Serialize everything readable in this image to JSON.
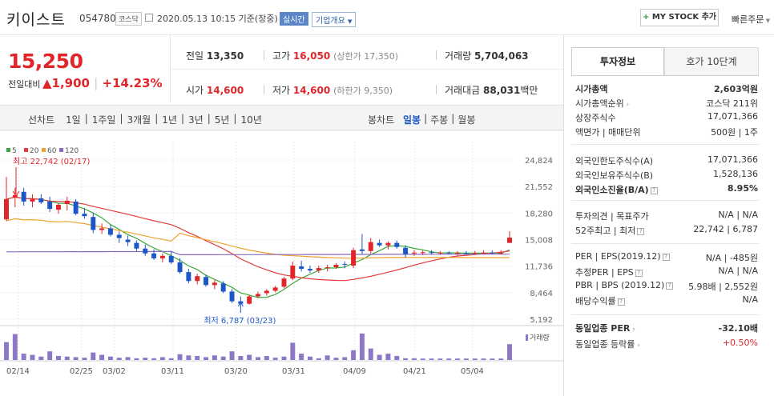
{
  "header": {
    "stock_name": "키이스트",
    "stock_code": "054780",
    "market": "코스닥",
    "datetime": "2020.05.13 10:15 기준(장중)",
    "realtime": "실시간",
    "company_info": "기업개요",
    "mystock": "MY STOCK 추가",
    "quick_order": "빠른주문"
  },
  "price": {
    "current": "15,250",
    "change_label": "전일대비",
    "change_amount": "1,900",
    "change_pct": "+14.23%",
    "prev_label": "전일",
    "prev": "13,350",
    "high_label": "고가",
    "high": "16,050",
    "upper_limit": "(상한가 17,350)",
    "volume_label": "거래량",
    "volume": "5,704,063",
    "open_label": "시가",
    "open": "14,600",
    "low_label": "저가",
    "low": "14,600",
    "lower_limit": "(하한가 9,350)",
    "amount_label": "거래대금",
    "amount": "88,031",
    "amount_unit": "백만"
  },
  "periods": {
    "line_chart": "선차트",
    "items": [
      "1일",
      "1주일",
      "3개월",
      "1년",
      "3년",
      "5년",
      "10년"
    ],
    "candle_chart": "봉차트",
    "candle_items": [
      "일봉",
      "주봉",
      "월봉"
    ],
    "candle_active": "일봉"
  },
  "chart_data": {
    "type": "candlestick",
    "legend": [
      "5",
      "20",
      "60",
      "120"
    ],
    "legend_colors": [
      "#3aa83a",
      "#e33b3b",
      "#f0a030",
      "#8b6bc0"
    ],
    "y_ticks": [
      "24,824",
      "21,552",
      "18,280",
      "15,008",
      "11,736",
      "8,464",
      "5,192"
    ],
    "ylim": [
      5192,
      24824
    ],
    "x_labels": [
      "02/14",
      "02/25",
      "03/02",
      "03/11",
      "03/20",
      "03/31",
      "04/09",
      "04/21",
      "05/04"
    ],
    "high_label": "최고 22,742 (02/17)",
    "low_label": "최저 6,787 (03/23)",
    "volume_label": "거래량",
    "candles": [
      {
        "o": 17500,
        "h": 22742,
        "l": 17300,
        "c": 20000
      },
      {
        "o": 20200,
        "h": 21400,
        "l": 19000,
        "c": 20500
      },
      {
        "o": 20900,
        "h": 21400,
        "l": 19200,
        "c": 19700
      },
      {
        "o": 19700,
        "h": 20600,
        "l": 19000,
        "c": 20000
      },
      {
        "o": 20100,
        "h": 20600,
        "l": 19400,
        "c": 19600
      },
      {
        "o": 19700,
        "h": 20300,
        "l": 18400,
        "c": 18800
      },
      {
        "o": 18700,
        "h": 19500,
        "l": 18200,
        "c": 19300
      },
      {
        "o": 19400,
        "h": 20300,
        "l": 18600,
        "c": 19800
      },
      {
        "o": 19700,
        "h": 20000,
        "l": 18000,
        "c": 18200
      },
      {
        "o": 18200,
        "h": 18900,
        "l": 17600,
        "c": 17900
      },
      {
        "o": 17800,
        "h": 18300,
        "l": 15800,
        "c": 16200
      },
      {
        "o": 16200,
        "h": 17000,
        "l": 15700,
        "c": 16400
      },
      {
        "o": 16400,
        "h": 16800,
        "l": 15400,
        "c": 15600
      },
      {
        "o": 15600,
        "h": 16000,
        "l": 14600,
        "c": 15200
      },
      {
        "o": 15000,
        "h": 15500,
        "l": 14200,
        "c": 14700
      },
      {
        "o": 14600,
        "h": 14900,
        "l": 13600,
        "c": 13900
      },
      {
        "o": 13900,
        "h": 14400,
        "l": 13000,
        "c": 13300
      },
      {
        "o": 13300,
        "h": 13800,
        "l": 12500,
        "c": 12700
      },
      {
        "o": 12700,
        "h": 13300,
        "l": 12200,
        "c": 13000
      },
      {
        "o": 13000,
        "h": 13600,
        "l": 12000,
        "c": 12200
      },
      {
        "o": 12200,
        "h": 12700,
        "l": 10800,
        "c": 11000
      },
      {
        "o": 11000,
        "h": 11400,
        "l": 9600,
        "c": 9900
      },
      {
        "o": 9900,
        "h": 10800,
        "l": 9500,
        "c": 10500
      },
      {
        "o": 10400,
        "h": 10700,
        "l": 9200,
        "c": 9400
      },
      {
        "o": 9400,
        "h": 10000,
        "l": 8900,
        "c": 9700
      },
      {
        "o": 9600,
        "h": 9900,
        "l": 8400,
        "c": 8600
      },
      {
        "o": 8600,
        "h": 8900,
        "l": 7200,
        "c": 7400
      },
      {
        "o": 7400,
        "h": 8000,
        "l": 6787,
        "c": 7100
      },
      {
        "o": 7100,
        "h": 8200,
        "l": 7000,
        "c": 8000
      },
      {
        "o": 8000,
        "h": 8600,
        "l": 7800,
        "c": 8300
      },
      {
        "o": 8400,
        "h": 8900,
        "l": 8100,
        "c": 8700
      },
      {
        "o": 8700,
        "h": 9300,
        "l": 8500,
        "c": 9100
      },
      {
        "o": 9200,
        "h": 10400,
        "l": 9000,
        "c": 10200
      },
      {
        "o": 10200,
        "h": 12300,
        "l": 10000,
        "c": 11800
      },
      {
        "o": 11700,
        "h": 12400,
        "l": 11100,
        "c": 11400
      },
      {
        "o": 11400,
        "h": 11800,
        "l": 10900,
        "c": 11200
      },
      {
        "o": 11200,
        "h": 11800,
        "l": 10900,
        "c": 11500
      },
      {
        "o": 11500,
        "h": 11900,
        "l": 11100,
        "c": 11600
      },
      {
        "o": 11600,
        "h": 12100,
        "l": 11400,
        "c": 11900
      },
      {
        "o": 12000,
        "h": 12300,
        "l": 11500,
        "c": 11900
      },
      {
        "o": 11800,
        "h": 14000,
        "l": 11500,
        "c": 13700
      },
      {
        "o": 13800,
        "h": 15700,
        "l": 13200,
        "c": 13600
      },
      {
        "o": 13600,
        "h": 15200,
        "l": 13300,
        "c": 14700
      },
      {
        "o": 14600,
        "h": 15000,
        "l": 14100,
        "c": 14300
      },
      {
        "o": 14300,
        "h": 14800,
        "l": 13800,
        "c": 14600
      },
      {
        "o": 14600,
        "h": 14900,
        "l": 13900,
        "c": 14100
      },
      {
        "o": 14000,
        "h": 14300,
        "l": 12800,
        "c": 13200
      },
      {
        "o": 13300,
        "h": 13700,
        "l": 13000,
        "c": 13400
      },
      {
        "o": 13400,
        "h": 13700,
        "l": 13100,
        "c": 13450
      },
      {
        "o": 13450,
        "h": 13700,
        "l": 13150,
        "c": 13350
      },
      {
        "o": 13350,
        "h": 13600,
        "l": 13150,
        "c": 13400
      },
      {
        "o": 13400,
        "h": 13600,
        "l": 13200,
        "c": 13300
      },
      {
        "o": 13300,
        "h": 13600,
        "l": 13100,
        "c": 13350
      },
      {
        "o": 13350,
        "h": 13600,
        "l": 13150,
        "c": 13300
      },
      {
        "o": 13300,
        "h": 13600,
        "l": 13150,
        "c": 13350
      },
      {
        "o": 13350,
        "h": 13700,
        "l": 13200,
        "c": 13400
      },
      {
        "o": 13400,
        "h": 13650,
        "l": 13200,
        "c": 13350
      },
      {
        "o": 13350,
        "h": 13700,
        "l": 13200,
        "c": 13350
      },
      {
        "o": 14600,
        "h": 16050,
        "l": 14600,
        "c": 15250
      }
    ],
    "volumes": [
      0.62,
      0.9,
      0.22,
      0.18,
      0.12,
      0.3,
      0.14,
      0.12,
      0.1,
      0.08,
      0.26,
      0.18,
      0.12,
      0.08,
      0.1,
      0.06,
      0.08,
      0.06,
      0.1,
      0.06,
      0.2,
      0.16,
      0.14,
      0.1,
      0.16,
      0.12,
      0.3,
      0.14,
      0.18,
      0.1,
      0.14,
      0.08,
      0.12,
      0.6,
      0.22,
      0.12,
      0.06,
      0.16,
      0.08,
      0.1,
      0.34,
      0.92,
      0.4,
      0.18,
      0.22,
      0.14,
      0.06,
      0.06,
      0.05,
      0.05,
      0.05,
      0.05,
      0.05,
      0.05,
      0.05,
      0.05,
      0.05,
      0.05,
      0.55
    ]
  },
  "panel": {
    "tab_invest": "투자정보",
    "tab_order": "호가 10단계",
    "rows1": [
      {
        "label": "시가총액",
        "value": "2,603억원"
      },
      {
        "label": "시가총액순위",
        "value": "코스닥 211위"
      },
      {
        "label": "상장주식수",
        "value": "17,071,366"
      },
      {
        "label": "액면가 | 매매단위",
        "value": "500원 | 1주"
      }
    ],
    "rows2": [
      {
        "label": "외국인한도주식수(A)",
        "value": "17,071,366"
      },
      {
        "label": "외국인보유주식수(B)",
        "value": "1,528,136"
      },
      {
        "label": "외국인소진율(B/A)",
        "value": "8.95%"
      }
    ],
    "rows3": [
      {
        "label": "투자의견 | 목표주가",
        "value": "N/A | N/A"
      },
      {
        "label": "52주최고 | 최저",
        "value": "22,742 | 6,787"
      }
    ],
    "rows4": [
      {
        "label": "PER | EPS(2019.12)",
        "value": "N/A | -485원"
      },
      {
        "label": "추정PER | EPS",
        "value": "N/A | N/A"
      },
      {
        "label": "PBR | BPS (2019.12)",
        "value": "5.98배 | 2,552원"
      },
      {
        "label": "배당수익률",
        "value": "N/A"
      }
    ],
    "rows5": [
      {
        "label": "동일업종 PER",
        "value": "-32.10배"
      },
      {
        "label": "동일업종 등락률",
        "value": "+0.50%"
      }
    ]
  }
}
